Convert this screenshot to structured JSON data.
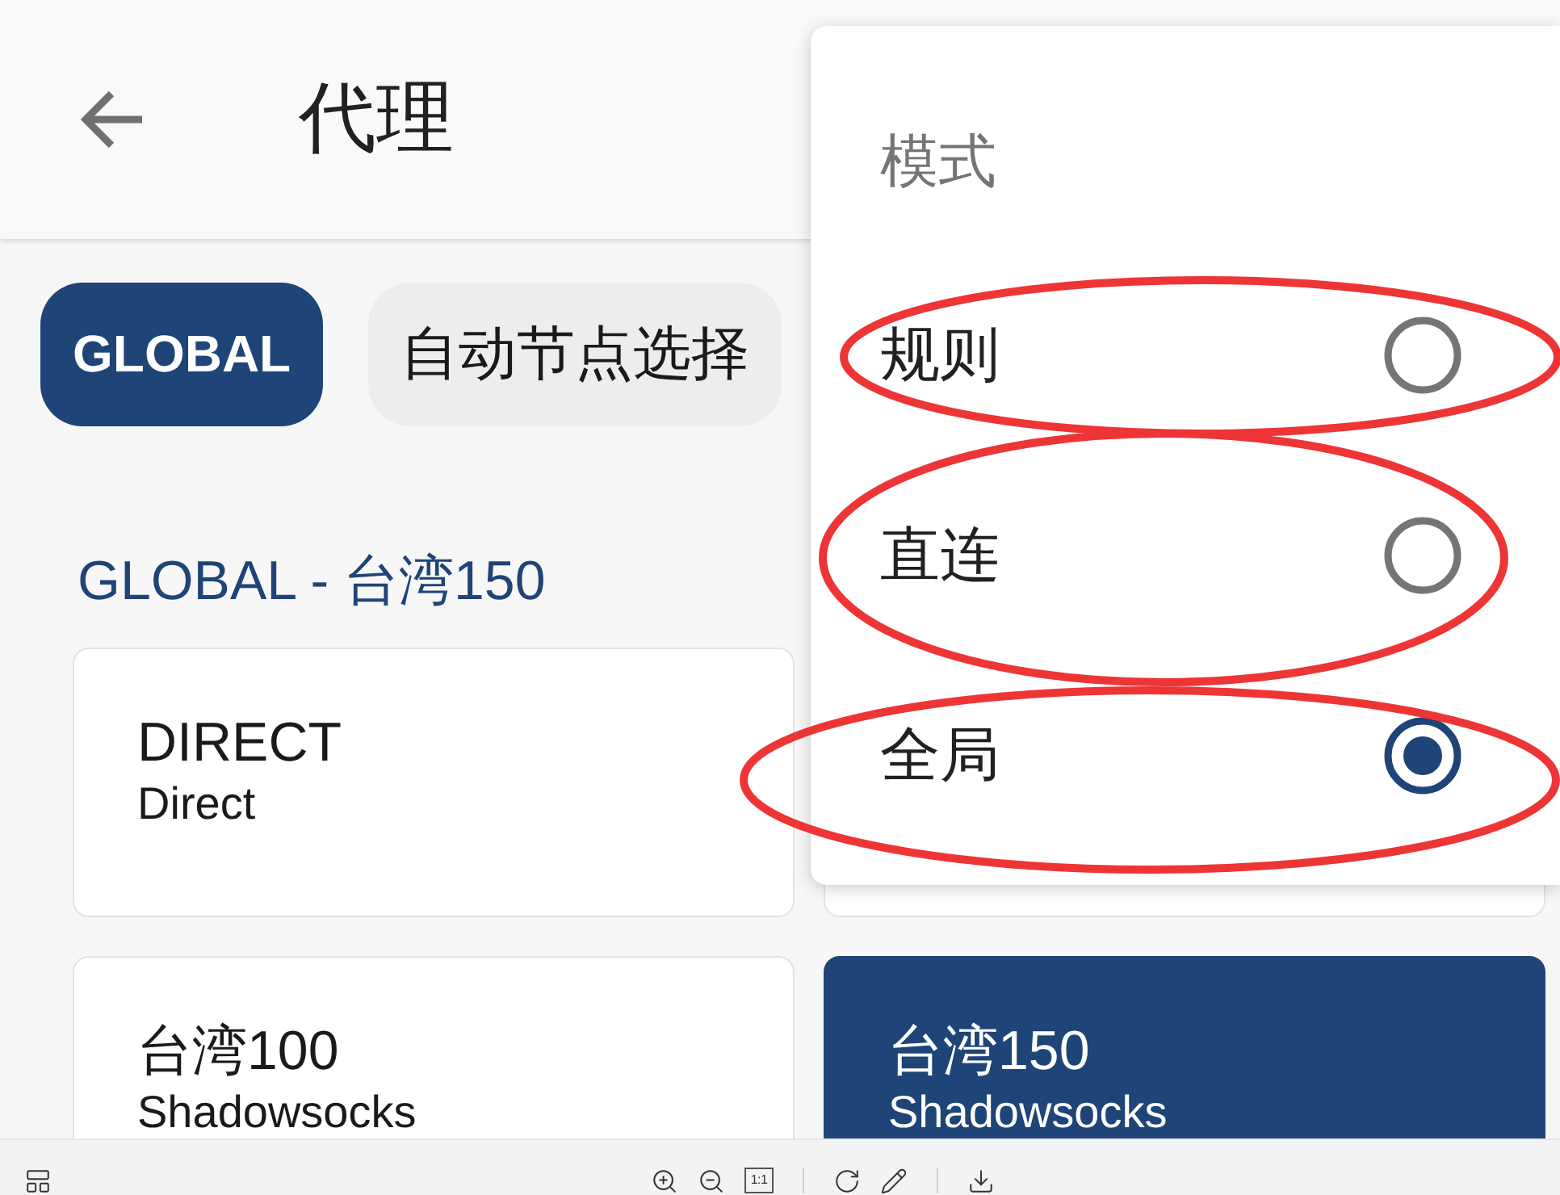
{
  "app_bar": {
    "title": "代理"
  },
  "groups": [
    {
      "label": "GLOBAL",
      "selected": true
    },
    {
      "label": "自动节点选择",
      "selected": false
    }
  ],
  "section": {
    "title": "GLOBAL - 台湾150"
  },
  "proxies": [
    {
      "name": "DIRECT",
      "type": "Direct",
      "selected": false
    },
    {
      "selected": false
    },
    {
      "name": "台湾100",
      "type": "Shadowsocks",
      "selected": false
    },
    {
      "name": "台湾150",
      "type": "Shadowsocks",
      "selected": true
    }
  ],
  "mode_menu": {
    "title": "模式",
    "options": [
      {
        "label": "规则",
        "selected": false,
        "circled": true
      },
      {
        "label": "直连",
        "selected": false,
        "circled": true
      },
      {
        "label": "全局",
        "selected": true,
        "circled": true
      }
    ]
  },
  "viewer_toolbar": {
    "actual_size_label": "1:1"
  }
}
